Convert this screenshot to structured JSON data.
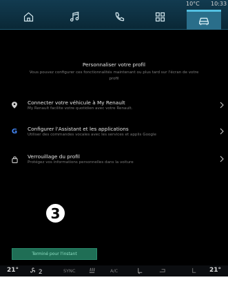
{
  "status": {
    "temp_out": "10°C",
    "clock": "10:33"
  },
  "nav": {
    "tabs": [
      {
        "icon": "home-icon"
      },
      {
        "icon": "music-icon"
      },
      {
        "icon": "phone-icon"
      },
      {
        "icon": "apps-grid-icon"
      },
      {
        "icon": "car-icon",
        "active": true
      }
    ],
    "accent": "#53c1e3"
  },
  "content": {
    "title": "Personnaliser votre profil",
    "subtitle": "Vous pouvez configurer ces fonctionnalités maintenant ou plus tard sur l'écran de votre\nprofil",
    "items": [
      {
        "icon": "location-pin-icon",
        "title": "Connecter votre véhicule à My Renault",
        "subtitle": "My Renault facilite votre quotidien avec votre Renault."
      },
      {
        "icon": "google-icon",
        "title": "Configurer l'Assistant et les applications",
        "subtitle": "Utiliser des commandes vocales avec les services et applis Google"
      },
      {
        "icon": "lock-icon",
        "title": "Verrouillage du profil",
        "subtitle": "Protégez vos informations personnelles dans la voiture"
      }
    ]
  },
  "callout": {
    "number": "3"
  },
  "done_button": {
    "label": "Terminé pour l'instant",
    "color": "#1f6e55"
  },
  "climate": {
    "left_temp": "21°",
    "fan_level": "2",
    "sync": "SYNC",
    "ac": "A/C",
    "right_temp": "21°"
  }
}
